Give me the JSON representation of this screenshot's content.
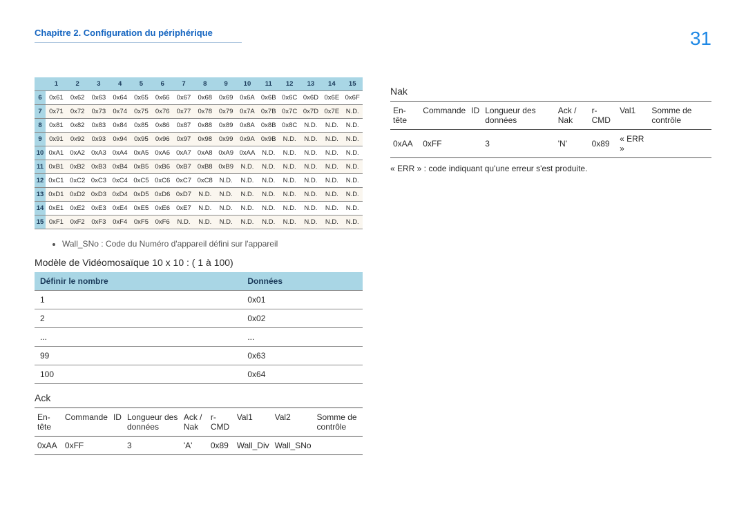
{
  "chapter": "Chapitre 2. Configuration du périphérique",
  "page": "31",
  "hex": {
    "cols": [
      "1",
      "2",
      "3",
      "4",
      "5",
      "6",
      "7",
      "8",
      "9",
      "10",
      "11",
      "12",
      "13",
      "14",
      "15"
    ],
    "rows": [
      {
        "h": "6",
        "c": [
          "0x61",
          "0x62",
          "0x63",
          "0x64",
          "0x65",
          "0x66",
          "0x67",
          "0x68",
          "0x69",
          "0x6A",
          "0x6B",
          "0x6C",
          "0x6D",
          "0x6E",
          "0x6F"
        ]
      },
      {
        "h": "7",
        "c": [
          "0x71",
          "0x72",
          "0x73",
          "0x74",
          "0x75",
          "0x76",
          "0x77",
          "0x78",
          "0x79",
          "0x7A",
          "0x7B",
          "0x7C",
          "0x7D",
          "0x7E",
          "N.D."
        ]
      },
      {
        "h": "8",
        "c": [
          "0x81",
          "0x82",
          "0x83",
          "0x84",
          "0x85",
          "0x86",
          "0x87",
          "0x88",
          "0x89",
          "0x8A",
          "0x8B",
          "0x8C",
          "N.D.",
          "N.D.",
          "N.D."
        ]
      },
      {
        "h": "9",
        "c": [
          "0x91",
          "0x92",
          "0x93",
          "0x94",
          "0x95",
          "0x96",
          "0x97",
          "0x98",
          "0x99",
          "0x9A",
          "0x9B",
          "N.D.",
          "N.D.",
          "N.D.",
          "N.D."
        ]
      },
      {
        "h": "10",
        "c": [
          "0xA1",
          "0xA2",
          "0xA3",
          "0xA4",
          "0xA5",
          "0xA6",
          "0xA7",
          "0xA8",
          "0xA9",
          "0xAA",
          "N.D.",
          "N.D.",
          "N.D.",
          "N.D.",
          "N.D."
        ]
      },
      {
        "h": "11",
        "c": [
          "0xB1",
          "0xB2",
          "0xB3",
          "0xB4",
          "0xB5",
          "0xB6",
          "0xB7",
          "0xB8",
          "0xB9",
          "N.D.",
          "N.D.",
          "N.D.",
          "N.D.",
          "N.D.",
          "N.D."
        ]
      },
      {
        "h": "12",
        "c": [
          "0xC1",
          "0xC2",
          "0xC3",
          "0xC4",
          "0xC5",
          "0xC6",
          "0xC7",
          "0xC8",
          "N.D.",
          "N.D.",
          "N.D.",
          "N.D.",
          "N.D.",
          "N.D.",
          "N.D."
        ]
      },
      {
        "h": "13",
        "c": [
          "0xD1",
          "0xD2",
          "0xD3",
          "0xD4",
          "0xD5",
          "0xD6",
          "0xD7",
          "N.D.",
          "N.D.",
          "N.D.",
          "N.D.",
          "N.D.",
          "N.D.",
          "N.D.",
          "N.D."
        ]
      },
      {
        "h": "14",
        "c": [
          "0xE1",
          "0xE2",
          "0xE3",
          "0xE4",
          "0xE5",
          "0xE6",
          "0xE7",
          "N.D.",
          "N.D.",
          "N.D.",
          "N.D.",
          "N.D.",
          "N.D.",
          "N.D.",
          "N.D."
        ]
      },
      {
        "h": "15",
        "c": [
          "0xF1",
          "0xF2",
          "0xF3",
          "0xF4",
          "0xF5",
          "0xF6",
          "N.D.",
          "N.D.",
          "N.D.",
          "N.D.",
          "N.D.",
          "N.D.",
          "N.D.",
          "N.D.",
          "N.D."
        ]
      }
    ]
  },
  "wall_note": "Wall_SNo : Code du Numéro d'appareil défini sur l'appareil",
  "model_title": "Modèle de Vidéomosaïque 10 x 10 : ( 1 à 100)",
  "def_headers": {
    "n": "Définir le nombre",
    "d": "Données"
  },
  "def_rows": [
    {
      "n": "1",
      "d": "0x01"
    },
    {
      "n": "2",
      "d": "0x02"
    },
    {
      "n": "...",
      "d": "..."
    },
    {
      "n": "99",
      "d": "0x63"
    },
    {
      "n": "100",
      "d": "0x64"
    }
  ],
  "ack": {
    "title": "Ack",
    "headers": [
      "En-tête",
      "Commande",
      "ID",
      "Longueur des données",
      "Ack / Nak",
      "r-CMD",
      "Val1",
      "Val2",
      "Somme de contrôle"
    ],
    "row": [
      "0xAA",
      "0xFF",
      "",
      "3",
      "'A'",
      "0x89",
      "Wall_Div",
      "Wall_SNo",
      ""
    ]
  },
  "nak": {
    "title": "Nak",
    "headers": [
      "En-tête",
      "Commande",
      "ID",
      "Longueur des données",
      "Ack / Nak",
      "r-CMD",
      "Val1",
      "Somme de contrôle"
    ],
    "row": [
      "0xAA",
      "0xFF",
      "",
      "3",
      "'N'",
      "0x89",
      "« ERR »",
      ""
    ]
  },
  "err_note": "« ERR » : code indiquant qu'une erreur s'est produite."
}
